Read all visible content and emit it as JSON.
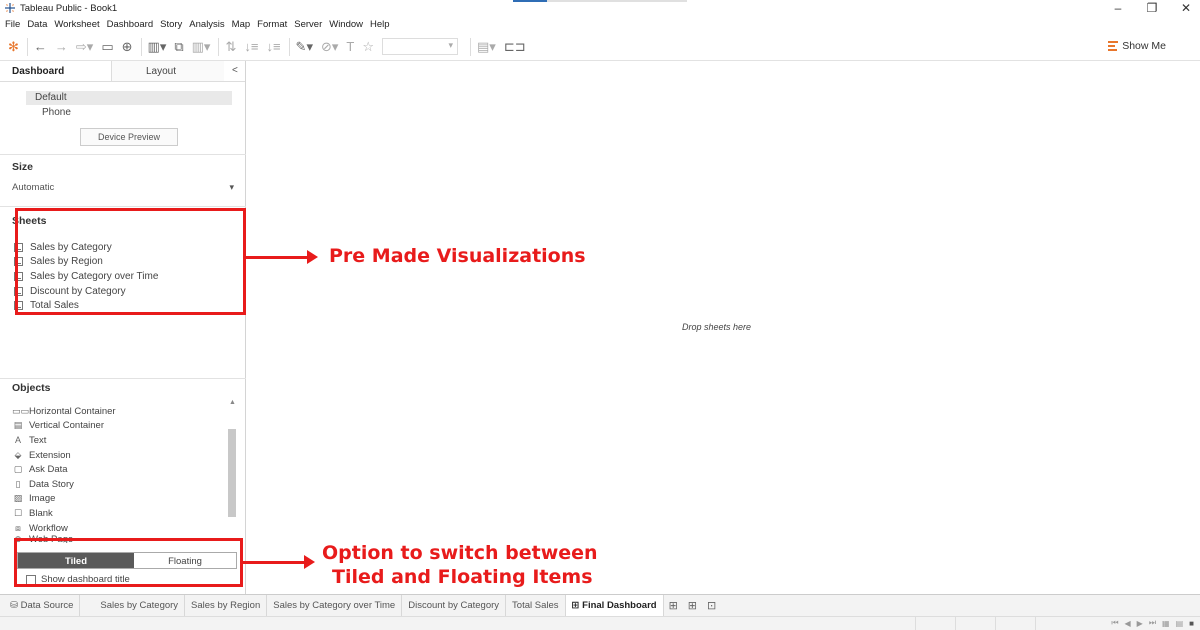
{
  "window": {
    "title": "Tableau Public - Book1",
    "controls": [
      "–",
      "❐",
      "✕"
    ]
  },
  "menu": [
    "File",
    "Data",
    "Worksheet",
    "Dashboard",
    "Story",
    "Analysis",
    "Map",
    "Format",
    "Server",
    "Window",
    "Help"
  ],
  "toolbar": {
    "show_me_label": "Show Me"
  },
  "left_panel": {
    "tabs": {
      "dashboard": "Dashboard",
      "layout": "Layout",
      "collapse": "<"
    },
    "device": {
      "default": "Default",
      "phone": "Phone",
      "preview_button": "Device Preview"
    },
    "size": {
      "title": "Size",
      "value": "Automatic"
    },
    "sheets": {
      "title": "Sheets",
      "items": [
        "Sales by Category",
        "Sales by Region",
        "Sales by Category over Time",
        "Discount by Category",
        "Total Sales"
      ]
    },
    "objects": {
      "title": "Objects",
      "items": [
        {
          "label": "Horizontal Container",
          "icon": "horizontal-container-icon"
        },
        {
          "label": "Vertical Container",
          "icon": "vertical-container-icon"
        },
        {
          "label": "Text",
          "icon": "text-icon"
        },
        {
          "label": "Extension",
          "icon": "extension-icon"
        },
        {
          "label": "Ask Data",
          "icon": "ask-data-icon"
        },
        {
          "label": "Data Story",
          "icon": "data-story-icon"
        },
        {
          "label": "Image",
          "icon": "image-icon"
        },
        {
          "label": "Blank",
          "icon": "blank-icon"
        },
        {
          "label": "Workflow",
          "icon": "workflow-icon"
        },
        {
          "label": "Web Page",
          "icon": "web-page-icon"
        }
      ]
    },
    "layout_mode": {
      "tiled": "Tiled",
      "floating": "Floating",
      "show_title": "Show dashboard title"
    }
  },
  "canvas": {
    "placeholder": "Drop sheets here"
  },
  "annotations": {
    "sheets": "Pre Made Visualizations",
    "tiled_line1": "Option to switch between",
    "tiled_line2": "Tiled and Floating Items",
    "color": "#e81b1b"
  },
  "sheet_tabs": {
    "data_source": "Data Source",
    "tabs": [
      "Sales by Category",
      "Sales by Region",
      "Sales by Category over Time",
      "Discount by Category",
      "Total Sales"
    ],
    "active": "Final Dashboard"
  }
}
